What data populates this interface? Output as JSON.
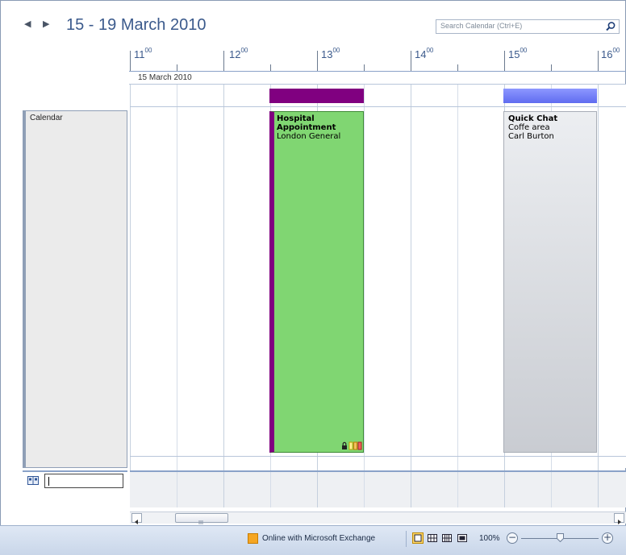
{
  "header": {
    "title": "15 - 19 March 2010",
    "prev_icon": "triangle-left-icon",
    "next_icon": "triangle-right-icon"
  },
  "search": {
    "placeholder": "Search Calendar (Ctrl+E)",
    "icon": "magnifier-icon"
  },
  "timeline": {
    "hours": [
      {
        "hour": "11",
        "minutes": "00"
      },
      {
        "hour": "12",
        "minutes": "00"
      },
      {
        "hour": "13",
        "minutes": "00"
      },
      {
        "hour": "14",
        "minutes": "00"
      },
      {
        "hour": "15",
        "minutes": "00"
      },
      {
        "hour": "16",
        "minutes": "00"
      }
    ],
    "day_label": "15 March 2010"
  },
  "calendar": {
    "label": "Calendar",
    "address_icon": "address-book-icon"
  },
  "appointments": [
    {
      "title": "Hospital Appointment",
      "location": "London General",
      "color": "#80d672",
      "bar_color": "#800080",
      "status_icons": [
        "lock-icon",
        "category-color-icons"
      ]
    },
    {
      "title": "Quick Chat",
      "location": "Coffe area",
      "organizer": "Carl Burton",
      "color": "#e2e4e8",
      "bar_color": "#6b78f0"
    }
  ],
  "status_bar": {
    "connection": "Online with Microsoft Exchange",
    "zoom": "100%",
    "zoom_out_icon": "minus-icon",
    "zoom_in_icon": "plus-icon"
  },
  "colors": {
    "accent": "#3b5a8c",
    "status_bar": "#c9d6e9"
  }
}
